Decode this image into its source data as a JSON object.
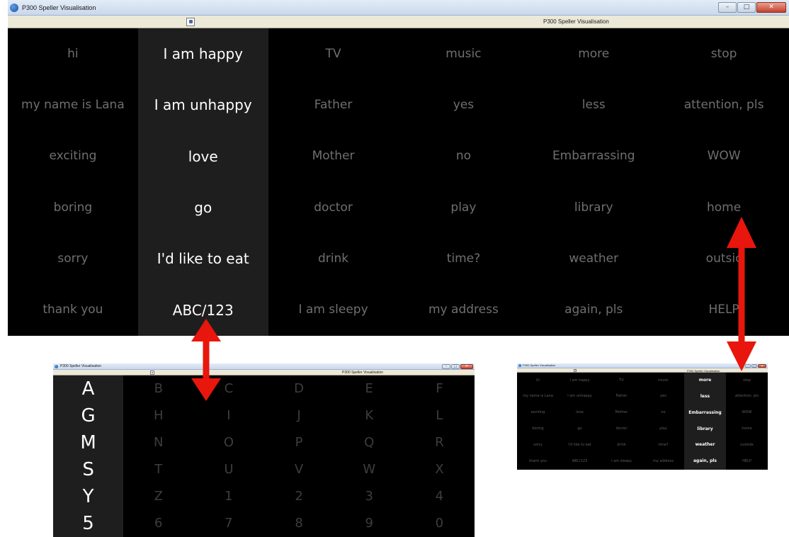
{
  "main_window": {
    "title": "P300 Speller Visualisation",
    "toolbar_title": "P300 Speller Visualisation",
    "highlighted_column": 1,
    "rows": [
      [
        "hi",
        "I am happy",
        "TV",
        "music",
        "more",
        "stop"
      ],
      [
        "my name is Lana",
        "I am unhappy",
        "Father",
        "yes",
        "less",
        "attention, pls"
      ],
      [
        "exciting",
        "love",
        "Mother",
        "no",
        "Embarrassing",
        "WOW"
      ],
      [
        "boring",
        "go",
        "doctor",
        "play",
        "library",
        "home"
      ],
      [
        "sorry",
        "I'd like to eat",
        "drink",
        "time?",
        "weather",
        "outsic"
      ],
      [
        "thank you",
        "ABC/123",
        "I am sleepy",
        "my address",
        "again, pls",
        "HELP"
      ]
    ]
  },
  "letter_window": {
    "title": "P300 Speller Visualisation",
    "toolbar_title": "P300 Speller Visualisation",
    "highlighted_column": 0,
    "rows": [
      [
        "A",
        "B",
        "C",
        "D",
        "E",
        "F"
      ],
      [
        "G",
        "H",
        "I",
        "J",
        "K",
        "L"
      ],
      [
        "M",
        "N",
        "O",
        "P",
        "Q",
        "R"
      ],
      [
        "S",
        "T",
        "U",
        "V",
        "W",
        "X"
      ],
      [
        "Y",
        "Z",
        "1",
        "2",
        "3",
        "4"
      ],
      [
        "5",
        "6",
        "7",
        "8",
        "9",
        "0"
      ]
    ]
  },
  "small_window": {
    "title": "P300 Speller Visualisation",
    "toolbar_title": "P300 Speller Visualisation",
    "highlighted_column": 4,
    "rows": [
      [
        "hi",
        "I am happy",
        "TV",
        "music",
        "more",
        "stop"
      ],
      [
        "my name is Lana",
        "I am unhappy",
        "Father",
        "yes",
        "less",
        "attention, pls"
      ],
      [
        "exciting",
        "love",
        "Mother",
        "no",
        "Embarrassing",
        "WOW"
      ],
      [
        "boring",
        "go",
        "doctor",
        "play",
        "library",
        "home"
      ],
      [
        "sorry",
        "I'd like to eat",
        "drink",
        "time?",
        "weather",
        "outside"
      ],
      [
        "thank you",
        "ABC/123",
        "I am sleepy",
        "my address",
        "again, pls",
        "HELP"
      ]
    ]
  },
  "window_buttons": {
    "minimize": "–",
    "maximize": "□",
    "close": "✕"
  },
  "colors": {
    "speller_background": "#000000",
    "highlight_column_background": "#1e1e1e",
    "highlight_text": "#ffffff",
    "dim_text": "#6f6f6f",
    "arrow": "#e8160c"
  },
  "icons": {
    "app": "p300-app-icon",
    "toolbar": "toolbar-window-icon",
    "arrows": [
      "double-headed-arrow-icon",
      "double-headed-arrow-icon"
    ]
  }
}
